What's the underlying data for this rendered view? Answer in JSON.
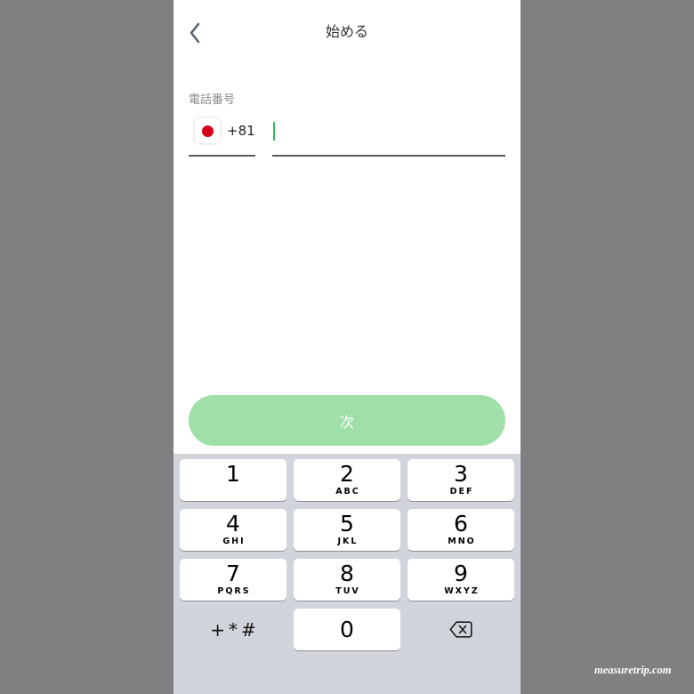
{
  "header": {
    "title": "始める",
    "back_icon": "chevron-left-icon"
  },
  "form": {
    "phone_label": "電話番号",
    "country": {
      "flag_icon": "japan-flag-icon",
      "code": "+81"
    },
    "phone_input": {
      "value": ""
    }
  },
  "next_button": {
    "label": "次",
    "enabled": false
  },
  "keypad": {
    "keys": [
      {
        "digit": "1"
      },
      {
        "digit": "2",
        "letters": "ABC"
      },
      {
        "digit": "3",
        "letters": "DEF"
      },
      {
        "digit": "4",
        "letters": "GHI"
      },
      {
        "digit": "5",
        "letters": "JKL"
      },
      {
        "digit": "6",
        "letters": "MNO"
      },
      {
        "digit": "7",
        "letters": "PQRS"
      },
      {
        "digit": "8",
        "letters": "TUV"
      },
      {
        "digit": "9",
        "letters": "WXYZ"
      }
    ],
    "symbols_label": "+*#",
    "zero": "0",
    "delete_icon": "backspace-icon"
  },
  "watermark": "measuretrip.com",
  "colors": {
    "accent": "#2ebd59",
    "button_bg": "#9fe0a9",
    "keyboard_bg": "#d1d4db",
    "flag_red": "#d4001a"
  }
}
